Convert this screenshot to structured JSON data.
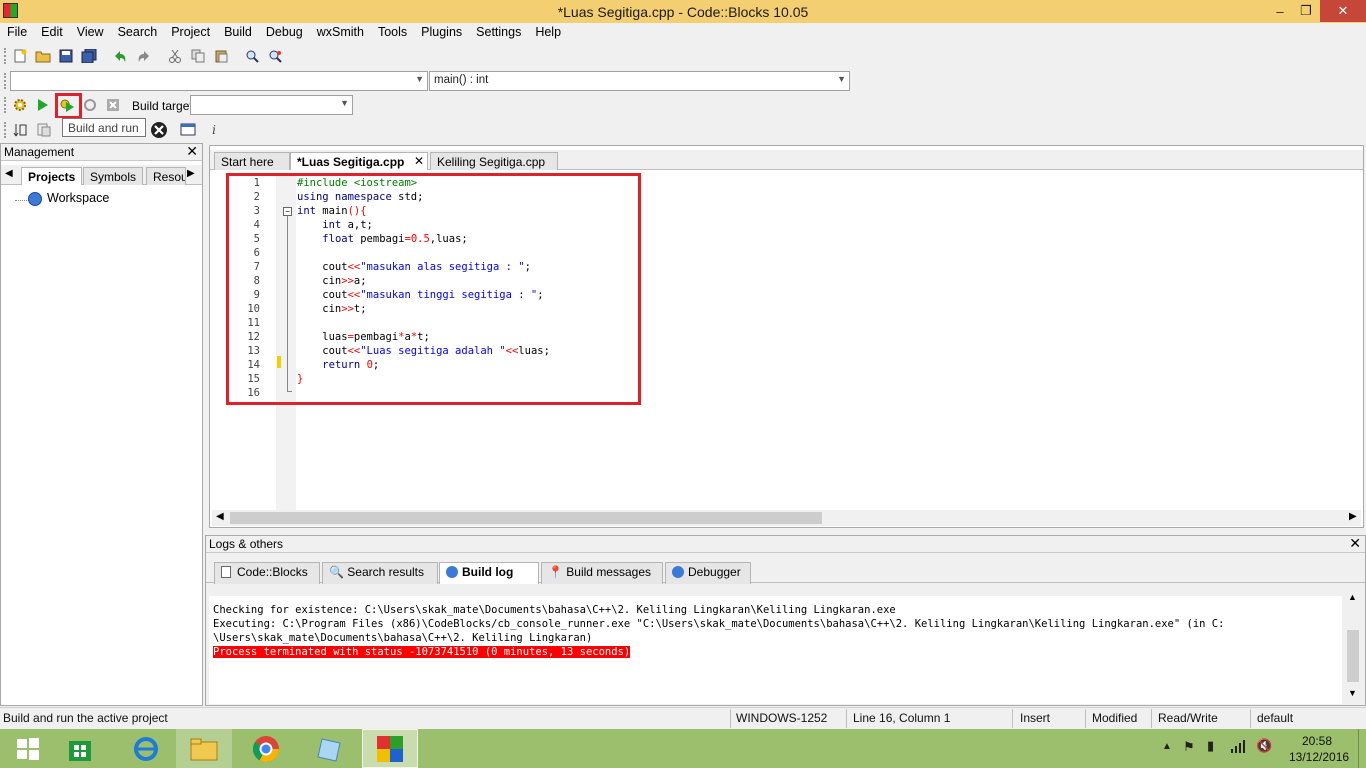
{
  "window": {
    "title": "*Luas Segitiga.cpp - Code::Blocks 10.05",
    "minimize": "–",
    "maximize": "❐",
    "close": "✕"
  },
  "menu": [
    "File",
    "Edit",
    "View",
    "Search",
    "Project",
    "Build",
    "Debug",
    "wxSmith",
    "Tools",
    "Plugins",
    "Settings",
    "Help"
  ],
  "toolbar": {
    "scope_combo": "",
    "function_combo": "main() : int",
    "build_target_label": "Build target:",
    "build_target_value": "",
    "tooltip": "Build and run"
  },
  "management": {
    "title": "Management",
    "tabs": [
      "Projects",
      "Symbols",
      "Resou"
    ],
    "tree": [
      "Workspace"
    ]
  },
  "editor": {
    "tabs": [
      "Start here",
      "*Luas Segitiga.cpp",
      "Keliling Segitiga.cpp"
    ],
    "line_numbers": [
      "1",
      "2",
      "3",
      "4",
      "5",
      "6",
      "7",
      "8",
      "9",
      "10",
      "11",
      "12",
      "13",
      "14",
      "15",
      "16"
    ]
  },
  "logs": {
    "title": "Logs & others",
    "tabs": [
      "Code::Blocks",
      "Search results",
      "Build log",
      "Build messages",
      "Debugger"
    ],
    "lines": [
      "Checking for existence: C:\\Users\\skak_mate\\Documents\\bahasa\\C++\\2. Keliling Lingkaran\\Keliling Lingkaran.exe",
      "Executing: C:\\Program Files (x86)\\CodeBlocks/cb_console_runner.exe \"C:\\Users\\skak_mate\\Documents\\bahasa\\C++\\2. Keliling Lingkaran\\Keliling Lingkaran.exe\" (in C:",
      "\\Users\\skak_mate\\Documents\\bahasa\\C++\\2. Keliling Lingkaran)",
      "Process terminated with status -1073741510 (0 minutes, 13 seconds)"
    ]
  },
  "status": {
    "message": "Build and run the active project",
    "encoding": "WINDOWS-1252",
    "position": "Line 16, Column 1",
    "mode": "Insert",
    "modified": "Modified",
    "access": "Read/Write",
    "profile": "default"
  },
  "taskbar": {
    "time": "20:58",
    "date": "13/12/2016"
  },
  "colors": {
    "title_bar": "#f4cf72",
    "highlight": "#e0202a",
    "taskbar": "#9bbf6c",
    "keyword": "#00008b",
    "string": "#0000ff",
    "preprocessor": "#008000",
    "number": "#ff0000"
  }
}
